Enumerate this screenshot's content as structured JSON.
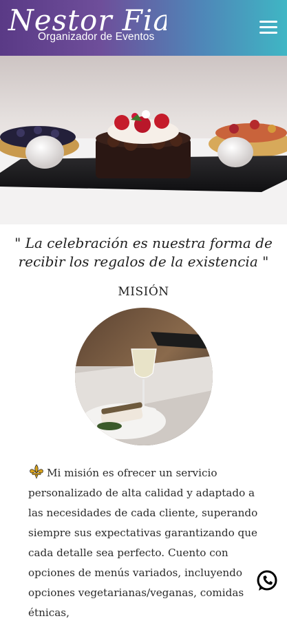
{
  "header": {
    "logo_script": "Nestor Fiant",
    "logo_subtitle": "Organizador de Eventos",
    "menu_icon": "hamburger-menu-icon"
  },
  "hero": {
    "image": "dessert-cake-photo"
  },
  "quote": "\" La celebración es nuestra forma de recibir los regalos de la existencia \"",
  "mission": {
    "title": "MISIÓN",
    "image": "wine-glass-dinner-photo",
    "icon": "fleur-de-lis-icon",
    "text": "Mi misión es ofrecer un servicio personalizado de alta calidad y adaptado a las necesidades de cada cliente, superando siempre sus expectativas garantizando que cada detalle sea perfecto. Cuento con opciones de menús variados, incluyendo opciones vegetarianas/veganas, comidas étnicas,"
  },
  "floating": {
    "whatsapp_icon": "whatsapp-icon"
  },
  "colors": {
    "header_start": "#5a3a86",
    "header_end": "#3fb6c4",
    "fleur": "#d9a21a"
  }
}
